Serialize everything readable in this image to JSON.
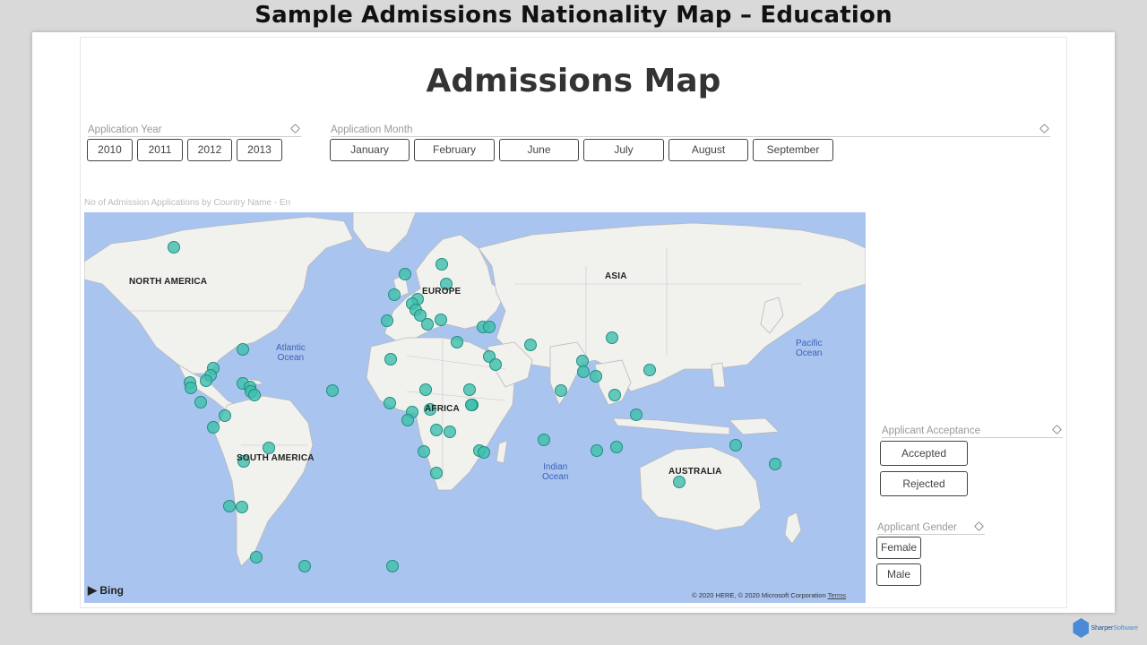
{
  "page_heading": "Sample Admissions Nationality Map – Education",
  "report_title": "Admissions Map",
  "application_year": {
    "label": "Application Year",
    "options": [
      "2010",
      "2011",
      "2012",
      "2013"
    ]
  },
  "application_month": {
    "label": "Application Month",
    "options": [
      "January",
      "February",
      "June",
      "July",
      "August",
      "September"
    ]
  },
  "map": {
    "caption": "No of Admission Applications by Country Name - En",
    "continents": {
      "north_america": "NORTH AMERICA",
      "europe": "EUROPE",
      "asia": "ASIA",
      "africa": "AFRICA",
      "south_america": "SOUTH AMERICA",
      "australia": "AUSTRALIA"
    },
    "oceans": {
      "atlantic": [
        "Atlantic",
        "Ocean"
      ],
      "pacific": [
        "Pacific",
        "Ocean"
      ],
      "indian": [
        "Indian",
        "Ocean"
      ]
    },
    "bing_label": "Bing",
    "copyright": "© 2020 HERE, © 2020 Microsoft Corporation",
    "terms": "Terms",
    "colors": {
      "water": "#a9c4ef",
      "land": "#f1f1ee",
      "border": "#b9b9b9",
      "bubble_fill": "#3fbfad",
      "bubble_stroke": "#1f8f7f"
    }
  },
  "applicant_acceptance": {
    "label": "Applicant Acceptance",
    "options": [
      "Accepted",
      "Rejected"
    ]
  },
  "applicant_gender": {
    "label": "Applicant Gender",
    "options": [
      "Female",
      "Male"
    ]
  },
  "brand": {
    "sharper": "Sharper",
    "software": "Software"
  }
}
